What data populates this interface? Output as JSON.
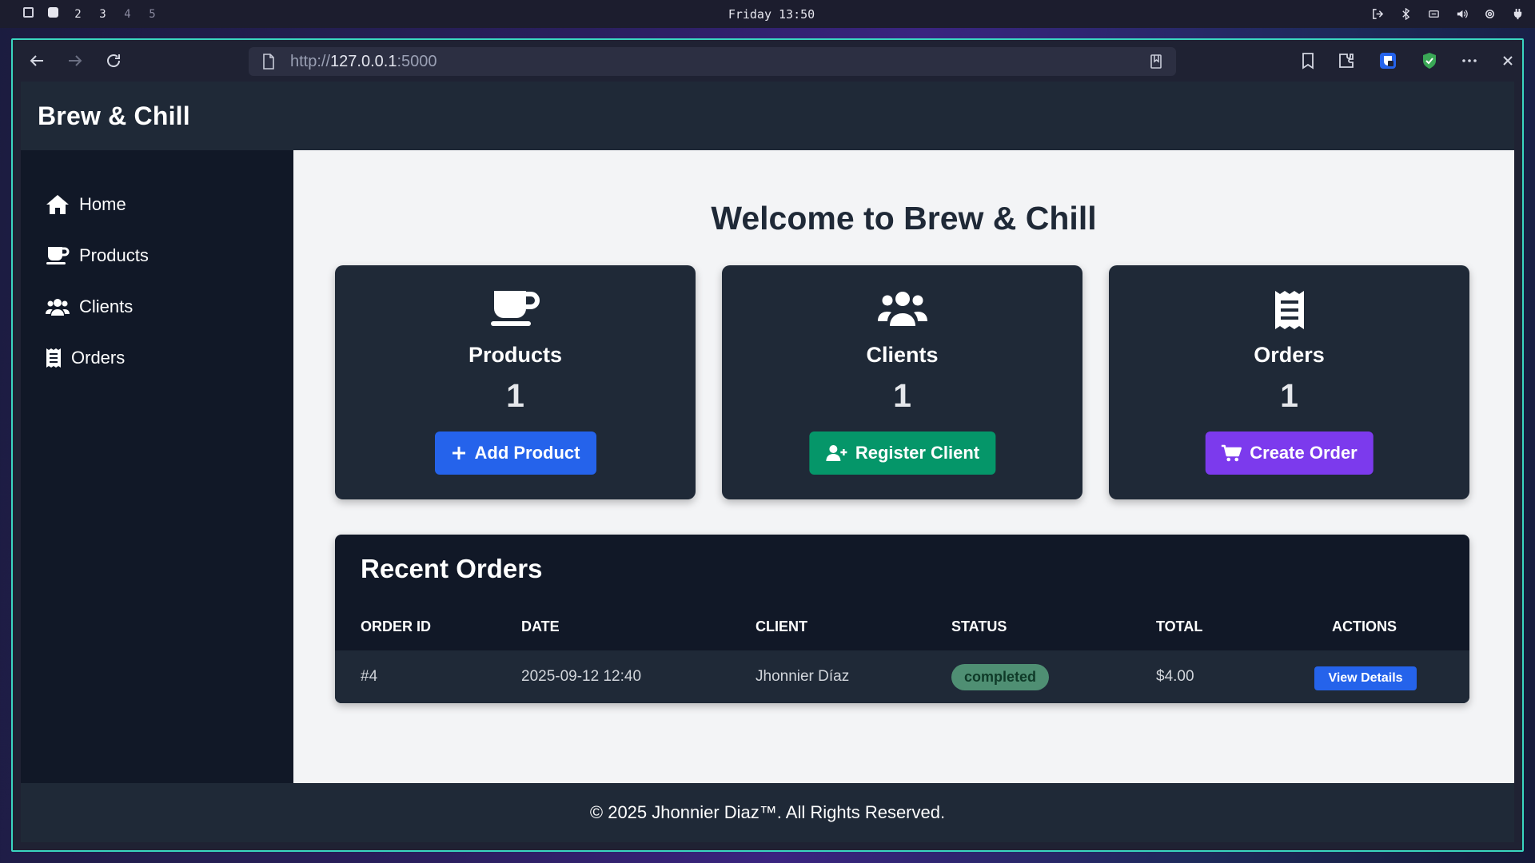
{
  "os": {
    "workspaces": [
      "2",
      "3",
      "4",
      "5"
    ],
    "clock": "Friday 13:50"
  },
  "browser": {
    "url_prefix": "http://",
    "url_host": "127.0.0.1",
    "url_suffix": ":5000"
  },
  "app": {
    "brand": "Brew & Chill",
    "sidebar": [
      {
        "label": "Home",
        "icon": "home-icon"
      },
      {
        "label": "Products",
        "icon": "coffee-cup-icon"
      },
      {
        "label": "Clients",
        "icon": "users-icon"
      },
      {
        "label": "Orders",
        "icon": "receipt-icon"
      }
    ],
    "welcome": "Welcome to Brew & Chill",
    "cards": [
      {
        "title": "Products",
        "count": "1",
        "button": "Add Product",
        "button_color": "#2563eb",
        "icon": "coffee-cup-icon",
        "button_icon": "plus-icon"
      },
      {
        "title": "Clients",
        "count": "1",
        "button": "Register Client",
        "button_color": "#059669",
        "icon": "users-icon",
        "button_icon": "user-plus-icon"
      },
      {
        "title": "Orders",
        "count": "1",
        "button": "Create Order",
        "button_color": "#7c3aed",
        "icon": "receipt-icon",
        "button_icon": "cart-icon"
      }
    ],
    "recent_orders": {
      "title": "Recent Orders",
      "columns": [
        "ORDER ID",
        "DATE",
        "CLIENT",
        "STATUS",
        "TOTAL",
        "ACTIONS"
      ],
      "rows": [
        {
          "id": "#4",
          "date": "2025-09-12 12:40",
          "client": "Jhonnier Díaz",
          "status": "completed",
          "total": "$4.00",
          "action": "View Details"
        }
      ]
    },
    "footer": "© 2025 Jhonnier Diaz™. All Rights Reserved."
  }
}
